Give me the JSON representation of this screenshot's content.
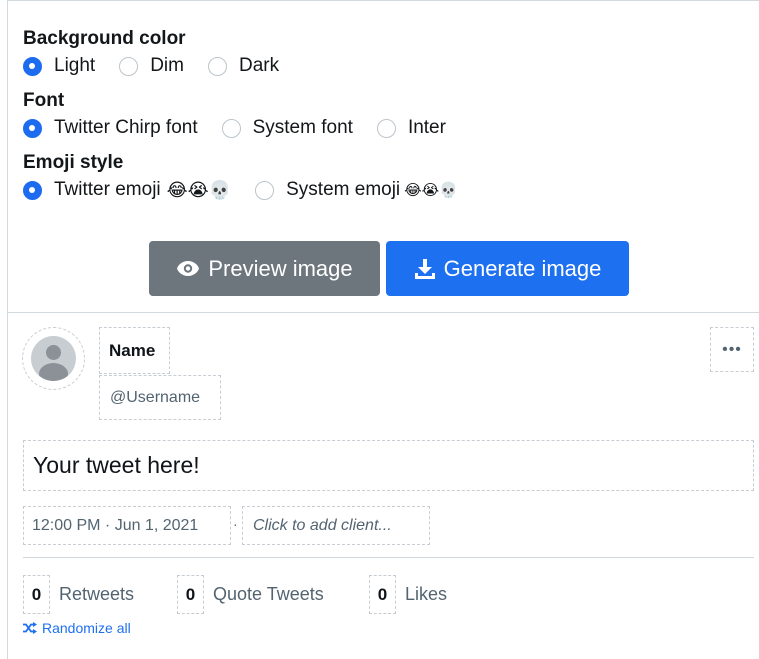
{
  "settings": {
    "background": {
      "title": "Background color",
      "options": [
        {
          "label": "Light",
          "selected": true
        },
        {
          "label": "Dim",
          "selected": false
        },
        {
          "label": "Dark",
          "selected": false
        }
      ]
    },
    "font": {
      "title": "Font",
      "options": [
        {
          "label": "Twitter Chirp font",
          "selected": true
        },
        {
          "label": "System font",
          "selected": false
        },
        {
          "label": "Inter",
          "selected": false
        }
      ]
    },
    "emoji": {
      "title": "Emoji style",
      "options": [
        {
          "label": "Twitter emoji",
          "emoji": "😂😭💀",
          "selected": true
        },
        {
          "label": "System emoji",
          "emoji": "😂😭💀",
          "selected": false
        }
      ]
    }
  },
  "actions": {
    "preview_label": "Preview image",
    "generate_label": "Generate image"
  },
  "tweet": {
    "name": "Name",
    "username": "@Username",
    "more": "•••",
    "text": "Your tweet here!",
    "timestamp": "12:00 PM · Jun 1, 2021",
    "separator": "·",
    "client_placeholder": "Click to add client...",
    "stats": {
      "retweets": {
        "count": "0",
        "label": "Retweets"
      },
      "quotes": {
        "count": "0",
        "label": "Quote Tweets"
      },
      "likes": {
        "count": "0",
        "label": "Likes"
      }
    },
    "randomize_label": "Randomize all"
  },
  "colors": {
    "accent": "#1d70f0",
    "preview_button": "#6d757d",
    "muted_text": "#536471",
    "dash_border": "#c7cdd2"
  },
  "icons": {
    "preview": "eye-icon",
    "generate": "download-icon",
    "randomize": "shuffle-icon",
    "more": "more-horizontal-icon",
    "avatar": "default-avatar-icon"
  }
}
